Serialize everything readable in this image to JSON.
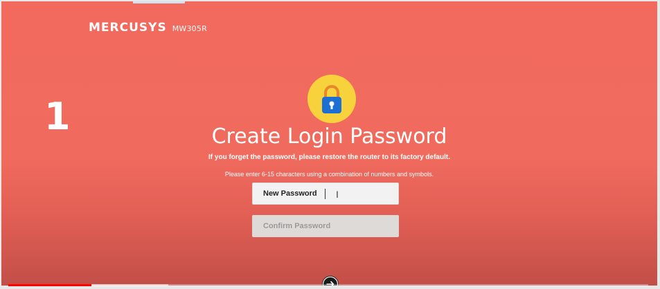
{
  "brand": {
    "logo": "MERCUSYS",
    "model": "MW305R"
  },
  "step": {
    "number": "1"
  },
  "page": {
    "title": "Create Login Password",
    "warning": "If you forget the password, please restore the router to its factory default.",
    "hint": "Please enter 6-15 characters using a combination of numbers and symbols."
  },
  "form": {
    "new_password_placeholder": "New Password",
    "confirm_password_placeholder": "Confirm Password"
  },
  "icons": {
    "lock": "lock-icon",
    "next": "arrow-right-icon",
    "cursor": "text-cursor-icon"
  },
  "colors": {
    "background": "#f26a5d",
    "lock_circle": "#f7d23c",
    "lock_body": "#1d6fd1",
    "progress_played": "#ff0000"
  },
  "video": {
    "played_fraction": 0.13,
    "buffered_fraction": 0.25
  }
}
